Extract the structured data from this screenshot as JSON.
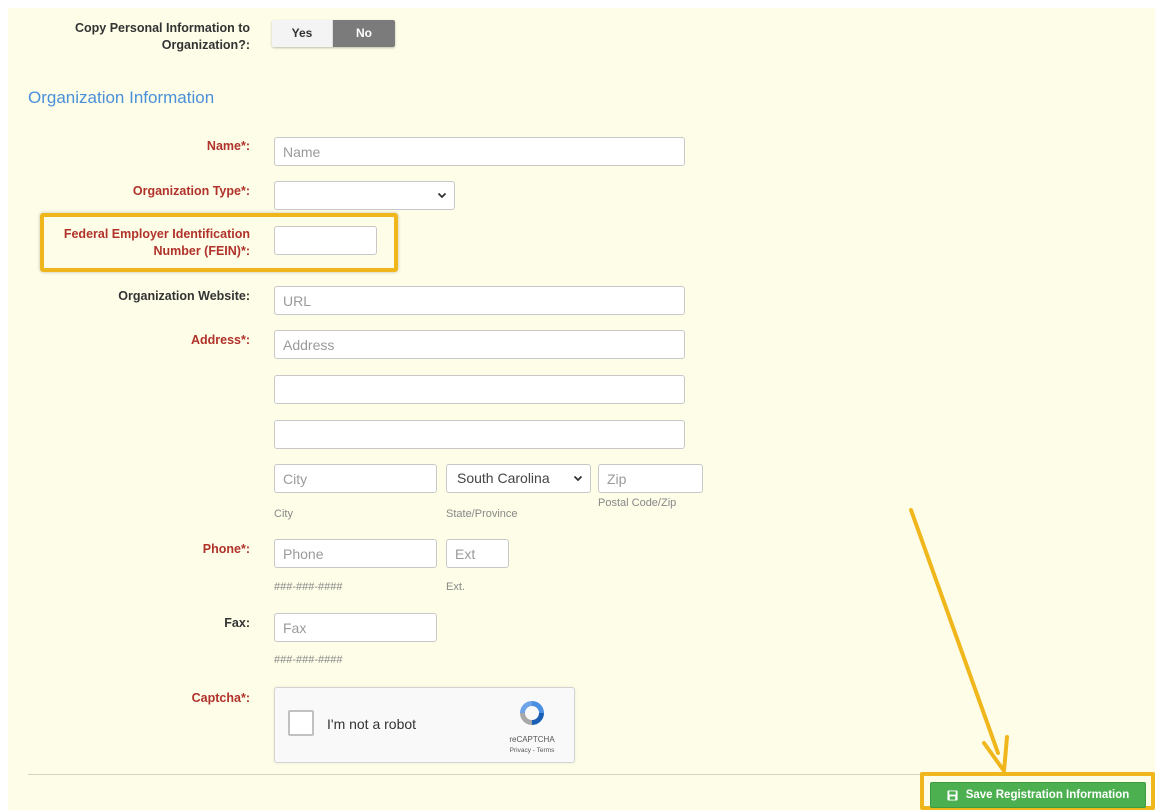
{
  "copy_toggle": {
    "label": "Copy Personal Information to Organization?:",
    "yes": "Yes",
    "no": "No",
    "selected": "No"
  },
  "section_title": "Organization Information",
  "fields": {
    "name": {
      "label": "Name*:",
      "placeholder": "Name"
    },
    "org_type": {
      "label": "Organization Type*:",
      "value": ""
    },
    "fein": {
      "label_line1": "Federal Employer Identification",
      "label_line2": "Number (FEIN)*:"
    },
    "website": {
      "label": "Organization Website:",
      "placeholder": "URL"
    },
    "address": {
      "label": "Address*:",
      "placeholder": "Address"
    },
    "city": {
      "placeholder": "City",
      "help": "City"
    },
    "state": {
      "value": "South Carolina",
      "help": "State/Province"
    },
    "zip": {
      "placeholder": "Zip",
      "help": "Postal Code/Zip"
    },
    "phone": {
      "label": "Phone*:",
      "placeholder": "Phone",
      "help": "###-###-####"
    },
    "ext": {
      "placeholder": "Ext",
      "help": "Ext."
    },
    "fax": {
      "label": "Fax:",
      "placeholder": "Fax",
      "help": "###-###-####"
    },
    "captcha": {
      "label": "Captcha*:",
      "checkbox_text": "I'm not a robot",
      "brand": "reCAPTCHA",
      "terms": "Privacy - Terms"
    }
  },
  "save_button": {
    "label": "Save Registration Information"
  },
  "colors": {
    "accent_highlight": "#f0b71c",
    "save_green": "#4caf50",
    "required_red": "#b0322a",
    "section_blue": "#4a90d9"
  }
}
